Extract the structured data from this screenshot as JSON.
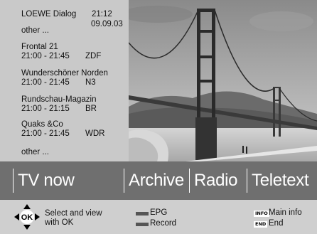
{
  "header": {
    "title": "LOEWE Dialog",
    "time": "21:12",
    "date": "09.09.03"
  },
  "program_list": {
    "other_top": "other ...",
    "other_bottom": "other ...",
    "entries": [
      {
        "title": "Frontal 21",
        "time": "21:00 - 21:45",
        "channel": "ZDF"
      },
      {
        "title": "Wunderschöner Norden",
        "time": "21:00 - 21:45",
        "channel": "N3"
      },
      {
        "title": "Rundschau-Magazin",
        "time": "21:00 - 21:15",
        "channel": "BR"
      },
      {
        "title": "Quaks &Co",
        "time": "21:00 - 21:45",
        "channel": "WDR"
      }
    ]
  },
  "menu": {
    "items": [
      "TV now",
      "Archive",
      "Radio",
      "Teletext"
    ]
  },
  "help": {
    "ok_label": "OK",
    "select_line1": "Select and view",
    "select_line2": "with OK",
    "epg_label": "EPG",
    "record_label": "Record",
    "info_key": "INFO",
    "info_label": "Main info",
    "end_key": "END",
    "end_label": "End"
  },
  "picture": {
    "icon": "golden-gate-bridge-photo"
  }
}
